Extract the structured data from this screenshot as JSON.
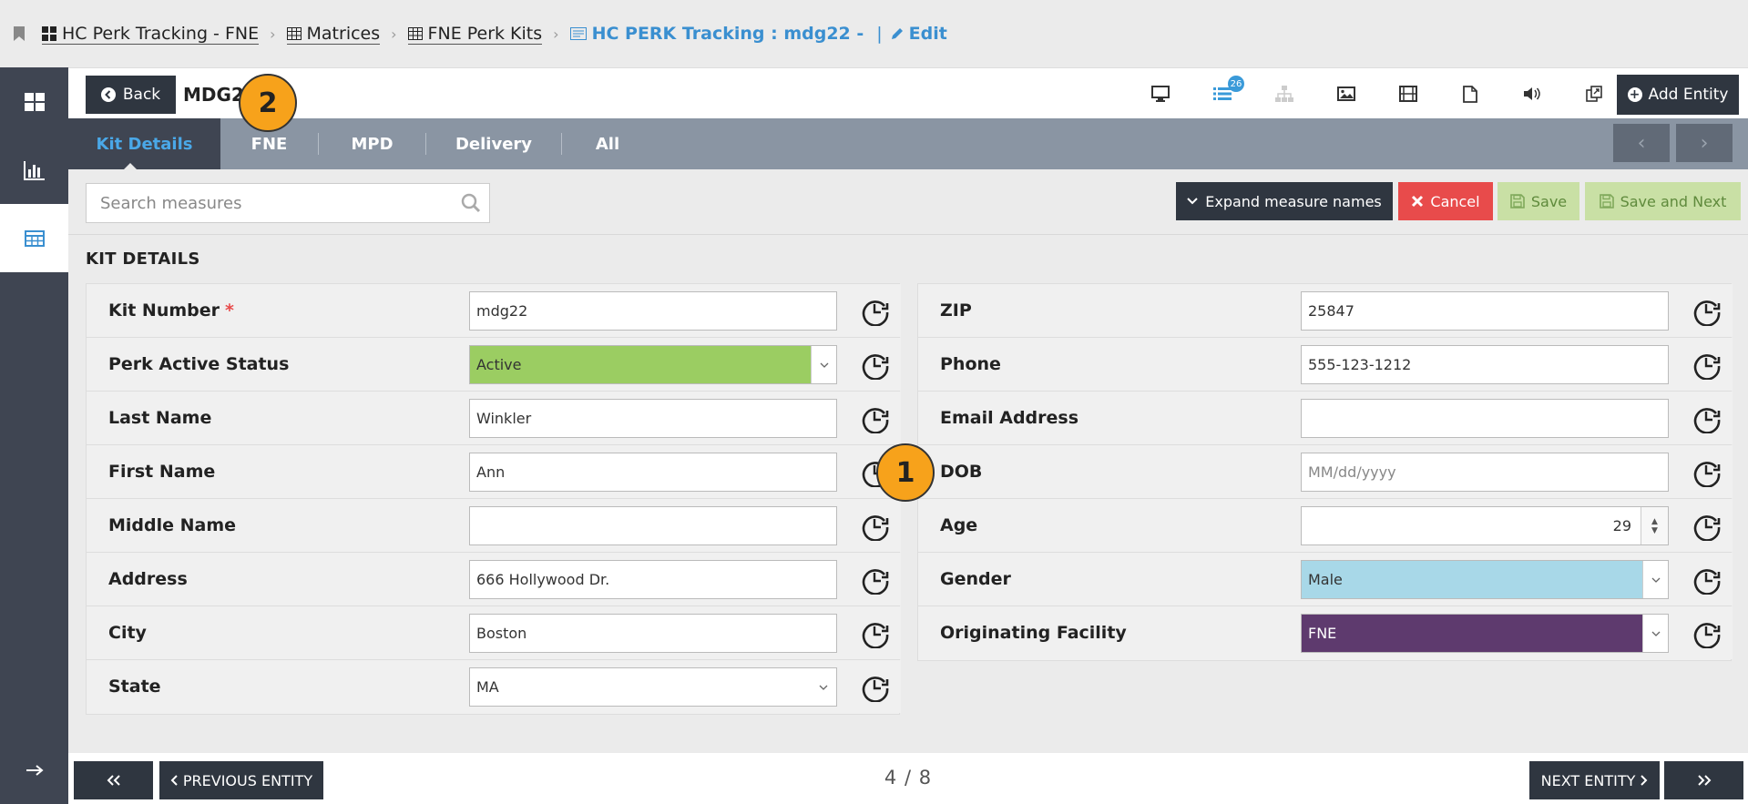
{
  "breadcrumbs": [
    {
      "label": "HC Perk Tracking - FNE",
      "icon": "dashboard-grid-icon"
    },
    {
      "label": "Matrices",
      "icon": "table-icon"
    },
    {
      "label": "FNE Perk Kits",
      "icon": "table-icon"
    },
    {
      "label": "HC PERK Tracking : mdg22  -",
      "icon": "list-card-icon"
    }
  ],
  "breadcrumb_edit": "Edit",
  "topbar": {
    "back_label": "Back",
    "entity_title": "MDG22",
    "view_badge": "26",
    "add_entity_label": "Add Entity"
  },
  "tabs": [
    {
      "label": "Kit Details",
      "active": true
    },
    {
      "label": "FNE"
    },
    {
      "label": "MPD"
    },
    {
      "label": "Delivery"
    },
    {
      "label": "All"
    }
  ],
  "toolbar": {
    "search_placeholder": "Search measures",
    "expand_label": "Expand measure names",
    "cancel_label": "Cancel",
    "save_label": "Save",
    "save_next_label": "Save and Next"
  },
  "section_title": "KIT DETAILS",
  "left_fields": [
    {
      "label": "Kit Number",
      "required": "*",
      "value": "mdg22"
    },
    {
      "label": "Perk Active Status",
      "value": "Active"
    },
    {
      "label": "Last Name",
      "value": "Winkler"
    },
    {
      "label": "First Name",
      "value": "Ann"
    },
    {
      "label": "Middle Name",
      "value": ""
    },
    {
      "label": "Address",
      "value": "666 Hollywood Dr."
    },
    {
      "label": "City",
      "value": "Boston"
    },
    {
      "label": "State",
      "value": "MA"
    }
  ],
  "right_fields": [
    {
      "label": "ZIP",
      "value": "25847"
    },
    {
      "label": "Phone",
      "value": "555-123-1212"
    },
    {
      "label": "Email Address",
      "value": ""
    },
    {
      "label": "DOB",
      "placeholder": "MM/dd/yyyy"
    },
    {
      "label": "Age",
      "value": "29"
    },
    {
      "label": "Gender",
      "value": "Male"
    },
    {
      "label": "Originating Facility",
      "value": "FNE"
    }
  ],
  "colors": {
    "active_status": "#9bcd62",
    "gender": "#a8d8e8",
    "facility": "#5e3a6e",
    "accent": "#3a8fd0",
    "cancel": "#e84b4b"
  },
  "callouts": [
    "1",
    "2"
  ],
  "footer": {
    "prev_label": "PREVIOUS ENTITY",
    "next_label": "NEXT ENTITY",
    "pager": "4 / 8"
  }
}
